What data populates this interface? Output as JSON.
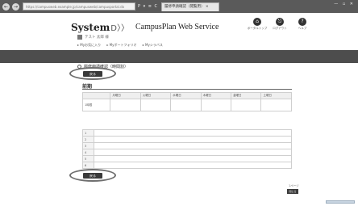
{
  "browser": {
    "nav_back": "←",
    "nav_forward": "→",
    "address": "https://campusweb.example.jp/campusweb/campusportal.do",
    "address_tools": "P ▾ ≡ C",
    "tab_title": "履修申請確認（閲覧用）",
    "tab_close": "×",
    "window_controls": "— ▫ ✕"
  },
  "brand": {
    "logo_text": "System",
    "logo_arrow": "D〉〉",
    "app_title": "CampusPlan Web Service"
  },
  "top_icons": [
    {
      "glyph": "⌂",
      "label": "ポータルトップ"
    },
    {
      "glyph": "⎋",
      "label": "ログアウト"
    },
    {
      "glyph": "?",
      "label": "ヘルプ"
    }
  ],
  "user": {
    "name": "テスト 太郎 様"
  },
  "breadcrumb": {
    "items": [
      "▸ Myお気に入り",
      "▸ Myポートフォリオ",
      "▸ Myシラバス"
    ]
  },
  "page": {
    "title": "履修申請確認（時間割）"
  },
  "buttons": {
    "top_button": "戻る",
    "bottom_button": "戻る"
  },
  "section": {
    "title": "前期"
  },
  "week_table": {
    "headers": [
      "",
      "月曜日",
      "火曜日",
      "水曜日",
      "木曜日",
      "金曜日",
      "土曜日"
    ],
    "rows": [
      [
        "1時限",
        "",
        "",
        "",
        "",
        "",
        ""
      ]
    ]
  },
  "list_table": {
    "rows": [
      [
        "1",
        ""
      ],
      [
        "2",
        ""
      ],
      [
        "3",
        ""
      ],
      [
        "4",
        ""
      ],
      [
        "5",
        ""
      ],
      [
        "6",
        ""
      ]
    ]
  },
  "right_mini": {
    "label": "1ページ",
    "button": "閉じる"
  },
  "colors": {
    "dark_band": "#4d4d4d",
    "button_bg": "#3a3a3a",
    "oval": "#6f6f6f"
  }
}
